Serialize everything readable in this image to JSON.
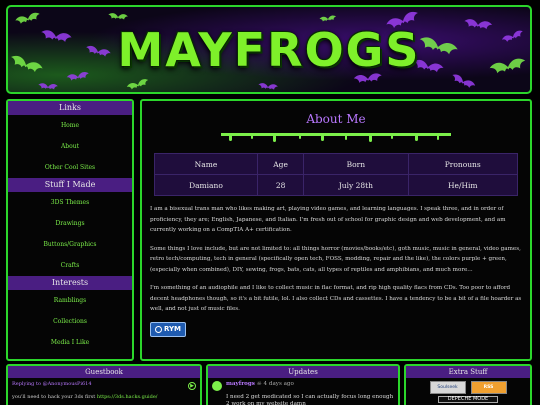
{
  "header": {
    "logo_text": "MAYFROGS"
  },
  "sidebar": {
    "sections": [
      {
        "title": "Links",
        "items": [
          "Home",
          "About",
          "Other Cool Sites"
        ]
      },
      {
        "title": "Stuff I Made",
        "items": [
          "3DS Themes",
          "Drawings",
          "Buttons/Graphics",
          "Crafts"
        ]
      },
      {
        "title": "Interests",
        "items": [
          "Ramblings",
          "Collections",
          "Media I Like"
        ]
      }
    ]
  },
  "main": {
    "title": "About Me",
    "table": {
      "headers": [
        "Name",
        "Age",
        "Born",
        "Pronouns"
      ],
      "values": [
        "Damiano",
        "28",
        "July 28th",
        "He/Him"
      ]
    },
    "paragraphs": [
      "I am a bisexual trans man who likes making art, playing video games, and learning languages. I speak three, and in order of proficiency, they are; English, Japanese, and Italian. I'm fresh out of school for graphic design and web development, and am currently working on a CompTIA A+ certification.",
      "Some things I love include, but are not limited to: all things horror (movies/books/etc), goth music, music in general, video games, retro tech/computing, tech in general (specifically open tech, FOSS, modding, repair and the like), the colors purple + green, (especially when combined), DIY, sewing, frogs, bats, cats, all types of reptiles and amphibians, and much more...",
      "I'm something of an audiophile and I like to collect music in flac format, and rip high quality flacs from CDs. Too poor to afford decent headphones though, so it's a bit futile, lol. I also collect CDs and cassettes. I have a tendency to be a bit of a file hoarder as well, and not just of music files."
    ],
    "rym_badge": "RYM"
  },
  "guestbook": {
    "title": "Guestbook",
    "reply_line": "Replying to @AnonymousPi614",
    "message_prefix": "you'll need to hack your 3ds first ",
    "message_link": "https://3ds.hacks.guide/"
  },
  "updates": {
    "title": "Updates",
    "user": "mayfrogs",
    "time": "4 days ago",
    "text": "I need 2 get medicated so I can actually focus long enough 2 work on my website damn"
  },
  "extra": {
    "title": "Extra Stuff",
    "badges": [
      "Soulseek",
      "RSS"
    ],
    "band": "DEPECHE MODE"
  },
  "colors": {
    "accent_green": "#2bd62b",
    "link_green": "#7cf04a",
    "purple_header": "#4a1e82",
    "title_purple": "#b978ff"
  }
}
